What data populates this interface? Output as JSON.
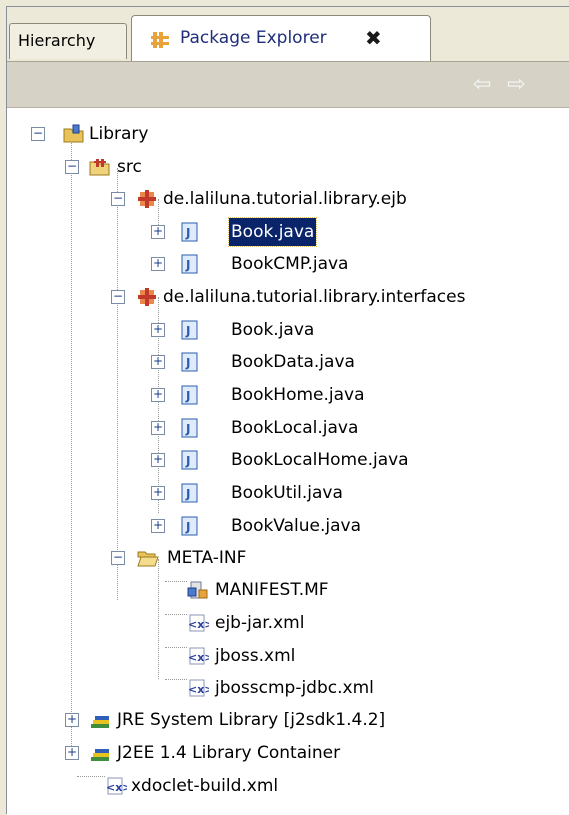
{
  "tabs": {
    "hierarchy": "Hierarchy",
    "package_explorer": "Package Explorer",
    "close_glyph": "✖"
  },
  "toolbar": {
    "back_glyph": "⇦",
    "forward_glyph": "⇨"
  },
  "tree": {
    "project": "Library",
    "src": "src",
    "pkg_ejb": "de.laliluna.tutorial.library.ejb",
    "ejb_files": [
      "Book.java",
      "BookCMP.java"
    ],
    "pkg_interfaces": "de.laliluna.tutorial.library.interfaces",
    "interface_files": [
      "Book.java",
      "BookData.java",
      "BookHome.java",
      "BookLocal.java",
      "BookLocalHome.java",
      "BookUtil.java",
      "BookValue.java"
    ],
    "meta_inf": "META-INF",
    "meta_files": [
      "MANIFEST.MF",
      "ejb-jar.xml",
      "jboss.xml",
      "jbosscmp-jdbc.xml"
    ],
    "jre_library": "JRE System Library [j2sdk1.4.2]",
    "j2ee_library": "J2EE 1.4 Library Container",
    "xdoclet_build": "xdoclet-build.xml"
  },
  "selected_item": "Book.java",
  "colors": {
    "selection": "#0a246a",
    "package_icon": "#c0392b",
    "java_icon": "#2a5db0",
    "folder_icon": "#e8c35a",
    "xml_icon": "#2b3f9e"
  }
}
